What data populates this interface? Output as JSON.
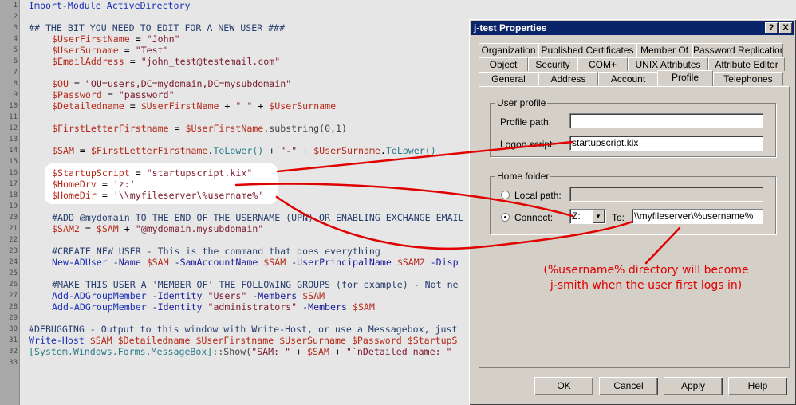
{
  "editor": {
    "line_numbers": [
      "1",
      "2",
      "3",
      "4",
      "5",
      "6",
      "7",
      "8",
      "9",
      "10",
      "11",
      "12",
      "13",
      "14",
      "15",
      "16",
      "17",
      "18",
      "19",
      "20",
      "21",
      "22",
      "23",
      "24",
      "25",
      "26",
      "27",
      "28",
      "29",
      "30",
      "31",
      "32",
      "33"
    ],
    "code": {
      "l1": "Import-Module ActiveDirectory",
      "l3": "## THE BIT YOU NEED TO EDIT FOR A NEW USER ###",
      "l4v": "$UserFirstName",
      "l4s": "\"John\"",
      "l5v": "$UserSurname",
      "l5s": "\"Test\"",
      "l6v": "$EmailAddress",
      "l6s": "\"john_test@testemail.com\"",
      "l8v": "$OU",
      "l8s": "\"OU=users,DC=mydomain,DC=mysubdomain\"",
      "l9v": "$Password",
      "l9s": "\"password\"",
      "l10v": "$Detailedname",
      "l10a": "$UserFirstName",
      "l10s": "\" \"",
      "l10b": "$UserSurname",
      "l12v": "$FirstLetterFirstname",
      "l12a": "$UserFirstName",
      "l12m": "substring(0,1)",
      "l14v": "$SAM",
      "l14a": "$FirstLetterFirstname",
      "l14m": "ToLower()",
      "l14s": "\"-\"",
      "l14b": "$UserSurname",
      "l14m2": "ToLower()",
      "l16v": "$StartupScript",
      "l16s": "\"startupscript.kix\"",
      "l17v": "$HomeDrv",
      "l17s": "'z:'",
      "l18v": "$HomeDir",
      "l18s": "'\\\\myfileserver\\%username%'",
      "l20": "#ADD @mydomain TO THE END OF THE USERNAME (UPN) OR ENABLING EXCHANGE EMAIL",
      "l21v": "$SAM2",
      "l21a": "$SAM",
      "l21s": "\"@mydomain.mysubdomain\"",
      "l23": "#CREATE NEW USER - This is the command that does everything",
      "l24k": "New-ADUser",
      "l24a": "-Name",
      "l24b": "$SAM",
      "l24c": "-SamAccountName",
      "l24d": "$SAM",
      "l24e": "-UserPrincipalName",
      "l24f": "$SAM2",
      "l24g": "-Disp",
      "l26": "#MAKE THIS USER A 'MEMBER OF' THE FOLLOWING GROUPS (for example) - Not ne",
      "l27k": "Add-ADGroupMember",
      "l27a": "-Identity",
      "l27s": "\"Users\"",
      "l27b": "-Members",
      "l27v": "$SAM",
      "l28k": "Add-ADGroupMember",
      "l28a": "-Identity",
      "l28s": "\"administrators\"",
      "l28b": "-Members",
      "l28v": "$SAM",
      "l30": "#DEBUGGING - Output to this window with Write-Host, or use a Messagebox, just",
      "l31k": "Write-Host",
      "l31a": "$SAM",
      "l31b": "$Detailedname",
      "l31c": "$UserFirstname",
      "l31d": "$UserSurname",
      "l31e": "$Password",
      "l31f": "$StartupS",
      "l32t": "[System.Windows.Forms.MessageBox]",
      "l32m": "::Show(",
      "l32s": "\"SAM: \"",
      "l32v": "$SAM",
      "l32s2": "\"`nDetailed name: \""
    }
  },
  "dialog": {
    "title": "j-test Properties",
    "help_btn": "?",
    "close_btn": "X",
    "tabs_row1": [
      "Organization",
      "Published Certificates",
      "Member Of",
      "Password Replication"
    ],
    "tabs_row2": [
      "Object",
      "Security",
      "COM+",
      "UNIX Attributes",
      "Attribute Editor"
    ],
    "tabs_row3": [
      "General",
      "Address",
      "Account",
      "Profile",
      "Telephones"
    ],
    "user_profile": {
      "group_label": "User profile",
      "profile_path_label": "Profile path:",
      "profile_path_value": "",
      "logon_script_label": "Logon script:",
      "logon_script_value": "startupscript.kix"
    },
    "home_folder": {
      "group_label": "Home folder",
      "local_path_label": "Local path:",
      "local_path_value": "",
      "connect_label": "Connect:",
      "drive_value": "Z:",
      "to_label": "To:",
      "to_value": "\\\\myfileserver\\%username%"
    },
    "buttons": {
      "ok": "OK",
      "cancel": "Cancel",
      "apply": "Apply",
      "help": "Help"
    }
  },
  "annotation": {
    "line1": "(%username% directory will become",
    "line2": "j-smith when the user first logs in)",
    "color": "#e00000"
  }
}
